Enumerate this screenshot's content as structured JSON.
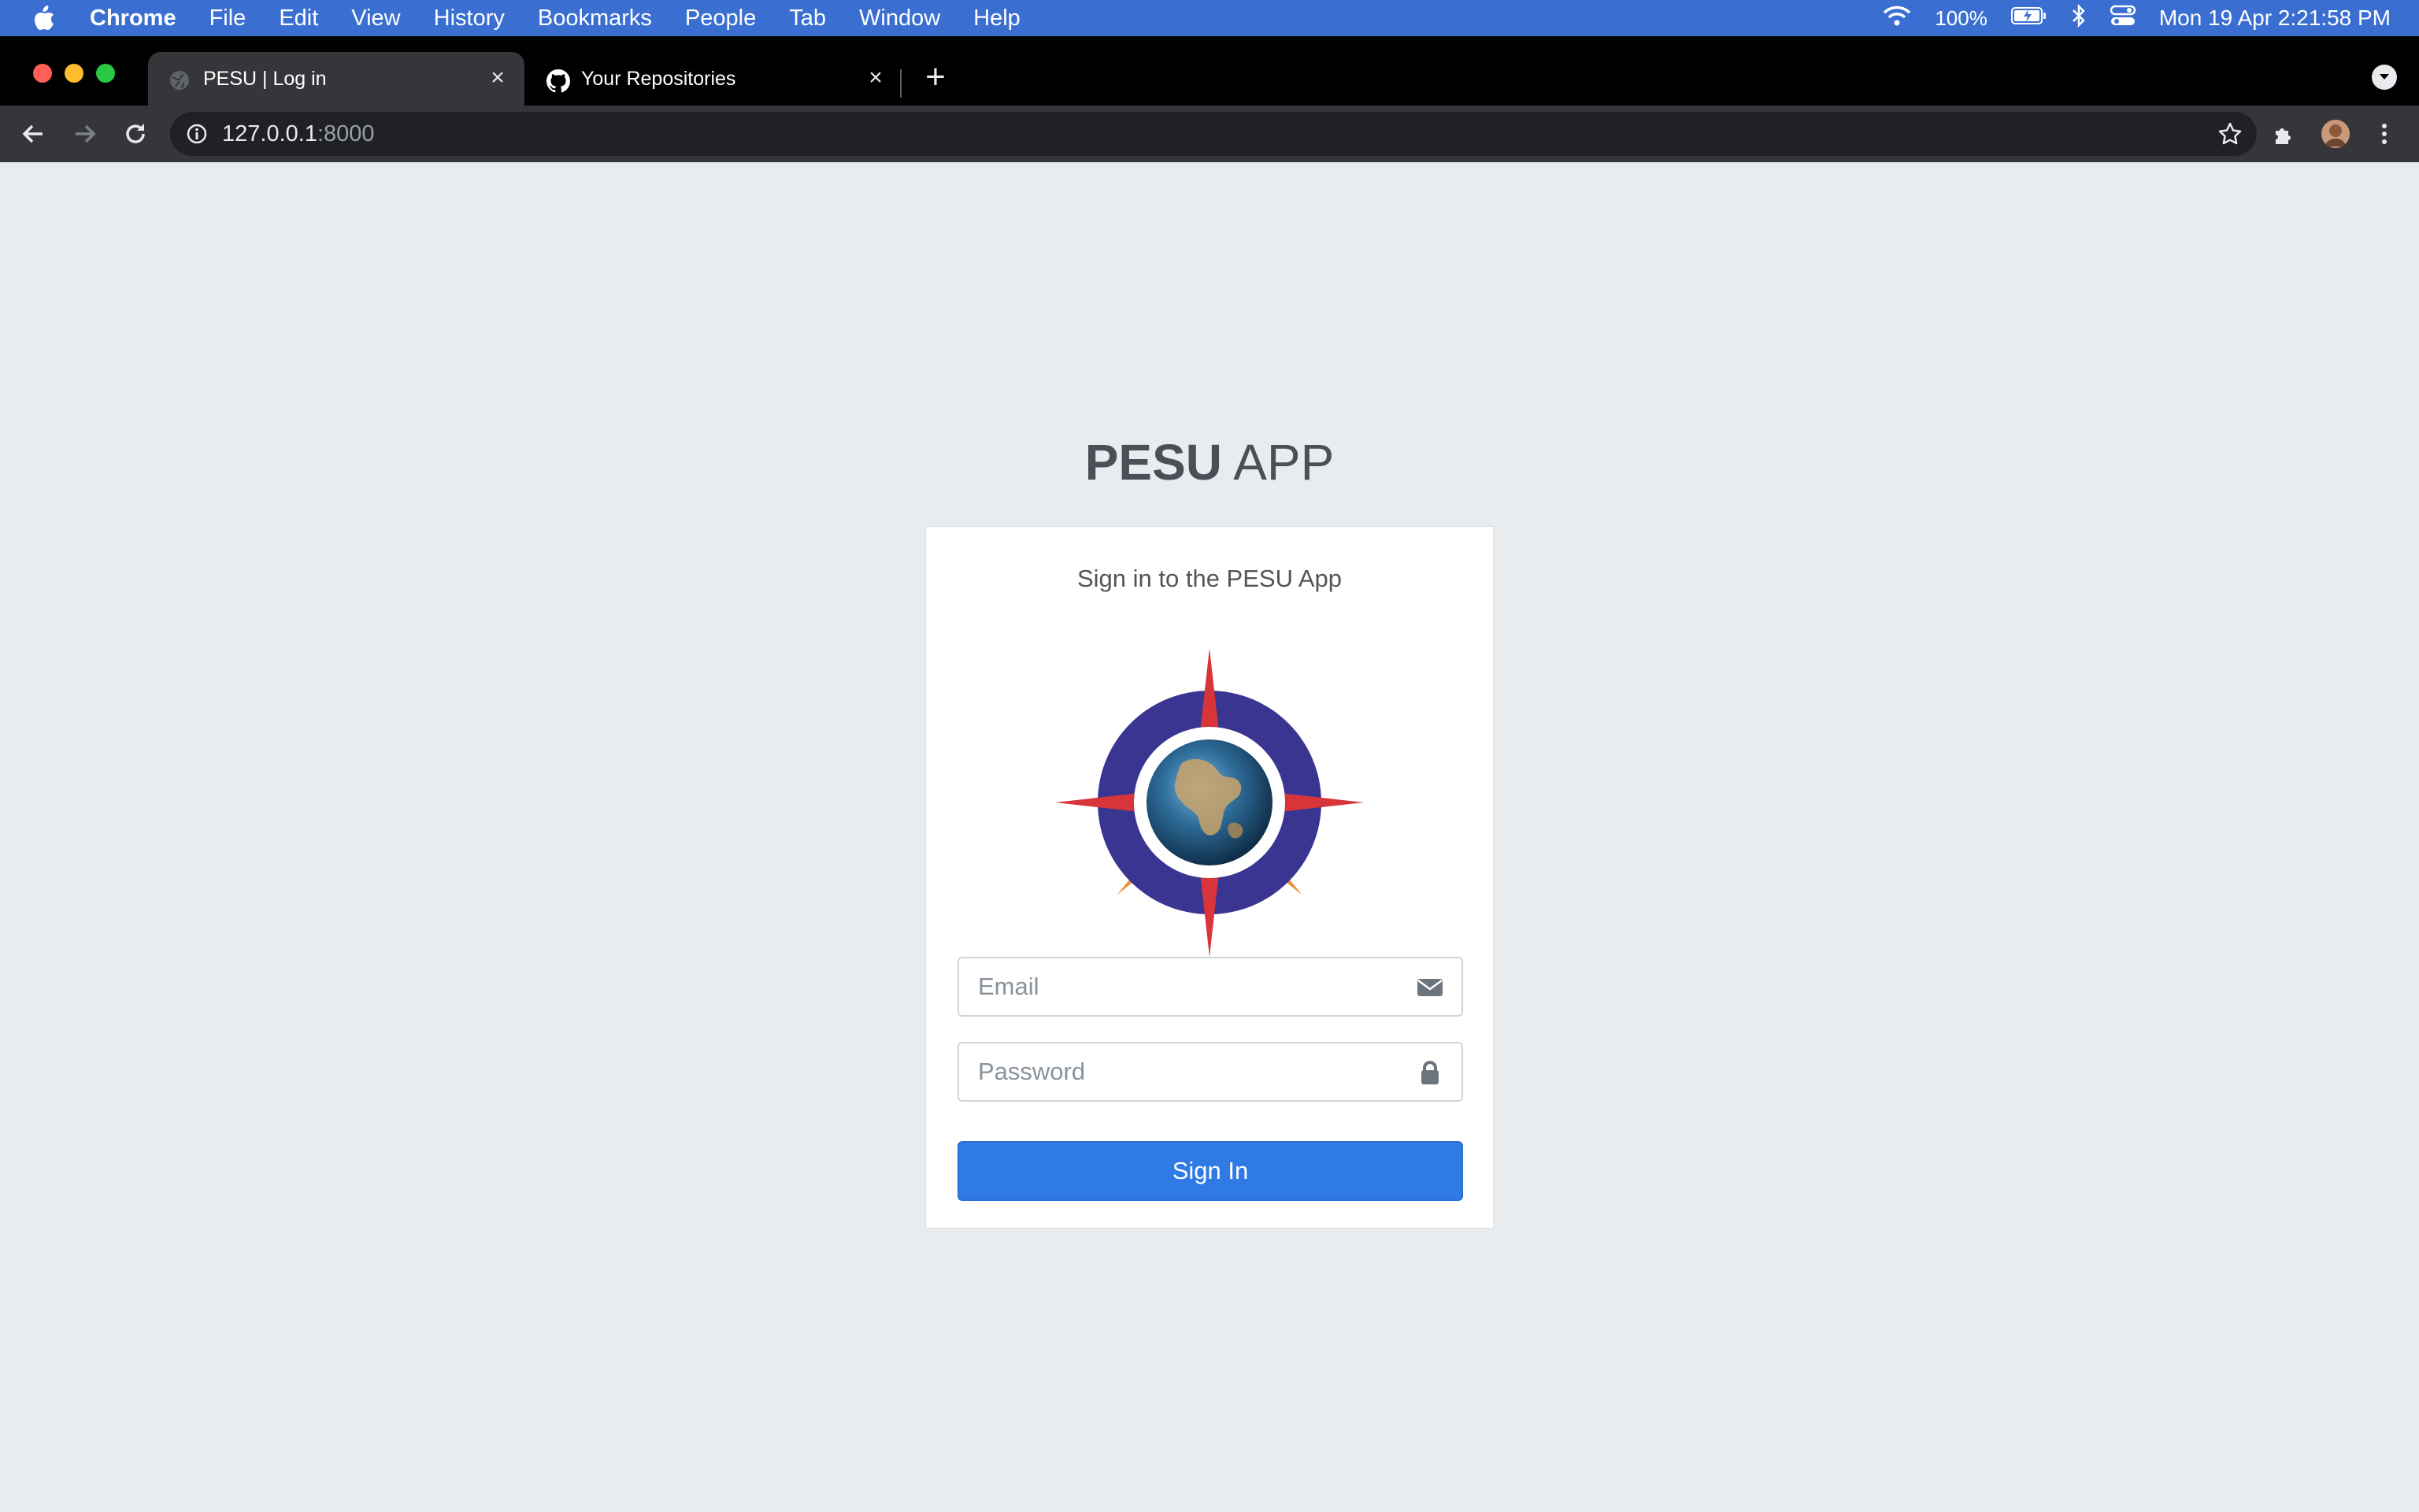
{
  "menubar": {
    "app_name": "Chrome",
    "items": [
      "File",
      "Edit",
      "View",
      "History",
      "Bookmarks",
      "People",
      "Tab",
      "Window",
      "Help"
    ],
    "battery": "100%",
    "clock": "Mon 19 Apr  2:21:58 PM",
    "status_icons": [
      "wifi-icon",
      "battery-icon",
      "bluetooth-icon",
      "control-center-icon"
    ]
  },
  "tabs": [
    {
      "title": "PESU | Log in",
      "active": true,
      "icon": "globe-icon"
    },
    {
      "title": "Your Repositories",
      "active": false,
      "icon": "github-icon"
    }
  ],
  "toolbar": {
    "url_host": "127.0.0.1",
    "url_port": ":8000"
  },
  "page": {
    "brand_bold": "PESU",
    "brand_light": " APP",
    "card_message": "Sign in to the PESU App",
    "email_placeholder": "Email",
    "password_placeholder": "Password",
    "signin_label": "Sign In"
  },
  "colors": {
    "menubar": "#3a6fd1",
    "tabstrip": "#000000",
    "toolbar": "#35363a",
    "page_bg": "#e9ecef",
    "primary_button": "#2f7ae5",
    "logo_ring": "#3b3592",
    "logo_red": "#d7353a",
    "logo_orange": "#ee8a34"
  }
}
